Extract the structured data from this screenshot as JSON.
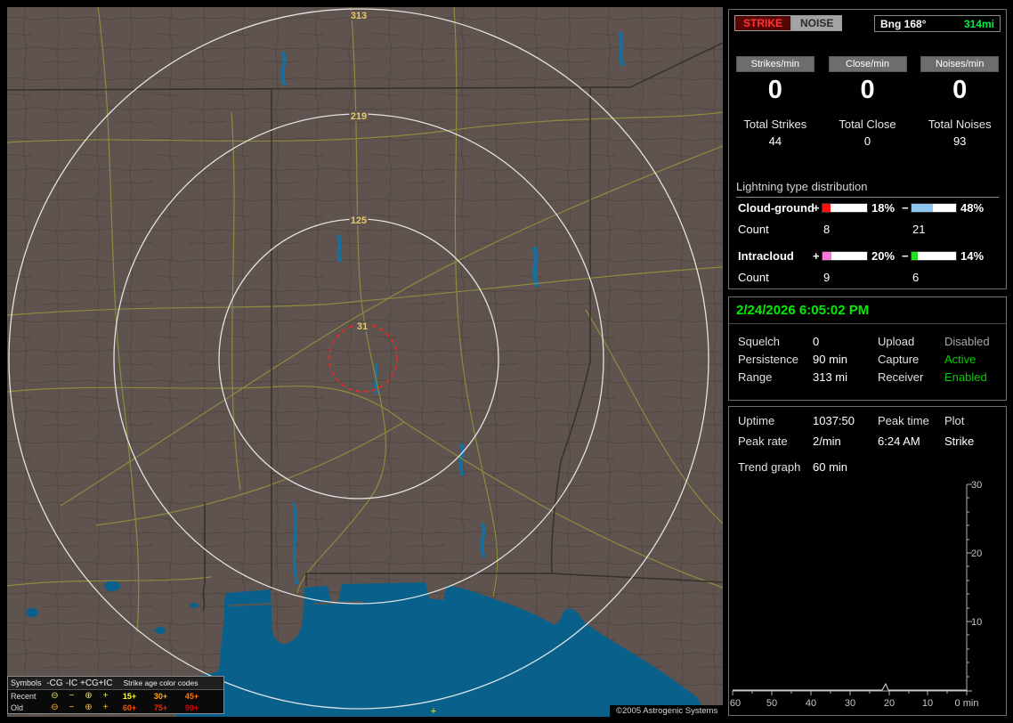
{
  "map": {
    "rings": [
      {
        "label": "313"
      },
      {
        "label": "219"
      },
      {
        "label": "125"
      },
      {
        "label": "31"
      }
    ],
    "strike_marker": "+",
    "copyright": "©2005 Astrogenic Systems",
    "legend": {
      "symbols_header": "Symbols",
      "col_headers": [
        "-CG",
        "-IC",
        "+CG",
        "+IC"
      ],
      "age_header": "Strike age color codes",
      "rows": [
        {
          "label": "Recent",
          "symbols": [
            "⊖",
            "−",
            "⊕",
            "+"
          ],
          "symbol_color": "#e0e060",
          "ages": [
            {
              "label": "15+",
              "color": "#ffff33"
            },
            {
              "label": "30+",
              "color": "#ffaa00"
            },
            {
              "label": "45+",
              "color": "#ff7700"
            }
          ]
        },
        {
          "label": "Old",
          "symbols": [
            "⊖",
            "−",
            "⊕",
            "+"
          ],
          "symbol_color": "#ffbb33",
          "ages": [
            {
              "label": "60+",
              "color": "#ff5500"
            },
            {
              "label": "75+",
              "color": "#ff2200"
            },
            {
              "label": "90+",
              "color": "#dd0000"
            }
          ]
        }
      ]
    }
  },
  "sidebar": {
    "header": {
      "strike_button": "STRIKE",
      "noise_button": "NOISE",
      "bearing": "Bng 168°",
      "bearing_distance": "314mi",
      "bearing_distance_color": "#00ee44"
    },
    "counters": [
      {
        "label": "Strikes/min",
        "value": "0"
      },
      {
        "label": "Close/min",
        "value": "0"
      },
      {
        "label": "Noises/min",
        "value": "0"
      }
    ],
    "totals": [
      {
        "label": "Total Strikes",
        "value": "44"
      },
      {
        "label": "Total Close",
        "value": "0"
      },
      {
        "label": "Total Noises",
        "value": "93"
      }
    ],
    "distribution": {
      "title": "Lightning type distribution",
      "count_label": "Count",
      "rows": [
        {
          "label": "Cloud-ground",
          "plus_sign": "+",
          "minus_sign": "−",
          "plus_pct": "18%",
          "plus_color": "#ff1010",
          "plus_count": "8",
          "minus_pct": "48%",
          "minus_color": "#8ec6f0",
          "minus_count": "21"
        },
        {
          "label": "Intracloud",
          "plus_sign": "+",
          "minus_sign": "−",
          "plus_pct": "20%",
          "plus_color": "#f878d8",
          "plus_count": "9",
          "minus_pct": "14%",
          "minus_color": "#22dd22",
          "minus_count": "6"
        }
      ]
    },
    "status": {
      "datetime": "2/24/2026 6:05:02 PM",
      "datetime_color": "#00ee00",
      "rows": [
        {
          "label1": "Squelch",
          "value1": "0",
          "label2": "Upload",
          "value2": "Disabled",
          "value2_color": "#a8a8a8"
        },
        {
          "label1": "Persistence",
          "value1": "90 min",
          "label2": "Capture",
          "value2": "Active",
          "value2_color": "#00cc00"
        },
        {
          "label1": "Range",
          "value1": "313 mi",
          "label2": "Receiver",
          "value2": "Enabled",
          "value2_color": "#00cc00"
        }
      ]
    },
    "stats": {
      "rows": [
        {
          "c1": "Uptime",
          "c2": "1037:50",
          "c3": "Peak time",
          "c4": "Plot"
        },
        {
          "c1": "Peak rate",
          "c2": "2/min",
          "c3": "6:24 AM",
          "c4": "Strike"
        }
      ],
      "trend_label": "Trend graph",
      "trend_value": "60 min"
    },
    "chart": {
      "y_ticks": [
        "30",
        "20",
        "10"
      ],
      "x_ticks": [
        "60",
        "50",
        "40",
        "30",
        "20",
        "10",
        "0 min"
      ]
    }
  }
}
